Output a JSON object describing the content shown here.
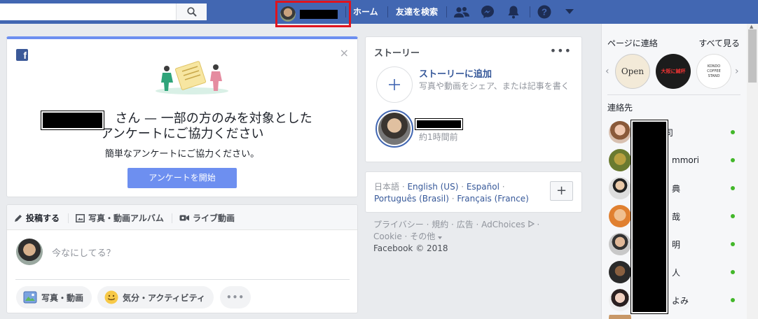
{
  "topbar": {
    "search_placeholder": "",
    "nav": {
      "home": "ホーム",
      "find_friends": "友達を検索"
    },
    "icons": [
      "friends-icon",
      "messenger-icon",
      "bell-icon",
      "help-icon",
      "dropdown-icon"
    ],
    "brand_color": "#4267b2"
  },
  "survey": {
    "title_line1": "さん — 一部の方のみを対象とした",
    "title_line2": "アンケートにご協力ください",
    "subtitle": "簡単なアンケートにご協力ください。",
    "button": "アンケートを開始",
    "close": "×",
    "fb_logo": "f",
    "accent_color": "#6d8ff0"
  },
  "composer": {
    "tabs": [
      "投稿する",
      "写真・動画アルバム",
      "ライブ動画"
    ],
    "placeholder": "今なにしてる？",
    "actions": [
      "写真・動画",
      "気分・アクティビティ",
      "•••"
    ]
  },
  "stories": {
    "title": "ストーリー",
    "more": "•••",
    "add_title": "ストーリーに追加",
    "add_desc": "写真や動画をシェア、または記事を書く",
    "story_time": "約1時間前"
  },
  "languages": {
    "current": "日本語",
    "links": [
      "English (US)",
      "Español",
      "Português (Brasil)",
      "Français (France)"
    ],
    "add": "+"
  },
  "footer": {
    "links": [
      "プライバシー",
      "規約",
      "広告",
      "AdChoices",
      "Cookie",
      "その他"
    ],
    "copyright": "Facebook © 2018"
  },
  "sidebar": {
    "pages_title": "ページに連絡",
    "see_all": "すべて見る",
    "pages": [
      "Open",
      "大阪に鍼杯",
      "KONDO COFFEE STAND"
    ],
    "contacts_title": "連絡先",
    "contacts": [
      {
        "name": "司"
      },
      {
        "name": "mmori"
      },
      {
        "name": "典"
      },
      {
        "name": "哉"
      },
      {
        "name": "明"
      },
      {
        "name": "人"
      },
      {
        "name": "よみ"
      }
    ],
    "online_color": "#42b72a"
  }
}
